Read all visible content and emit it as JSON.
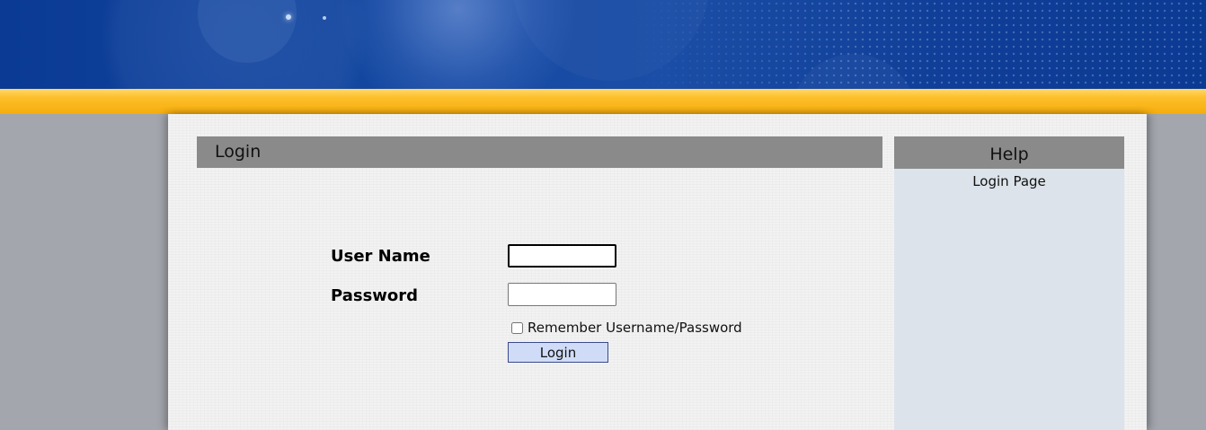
{
  "login_panel": {
    "title": "Login"
  },
  "form": {
    "username_label": "User Name",
    "username_value": "",
    "password_label": "Password",
    "password_value": "",
    "remember_label": "Remember Username/Password",
    "remember_checked": false,
    "login_button_label": "Login"
  },
  "help_panel": {
    "title": "Help",
    "text": "Login Page"
  },
  "colors": {
    "banner_blue": "#0f3d97",
    "gold_bar": "#fdbf2a",
    "panel_header_gray": "#8a8a8a",
    "help_background": "#dce3ea",
    "login_button_fill": "#d0dcf7"
  }
}
